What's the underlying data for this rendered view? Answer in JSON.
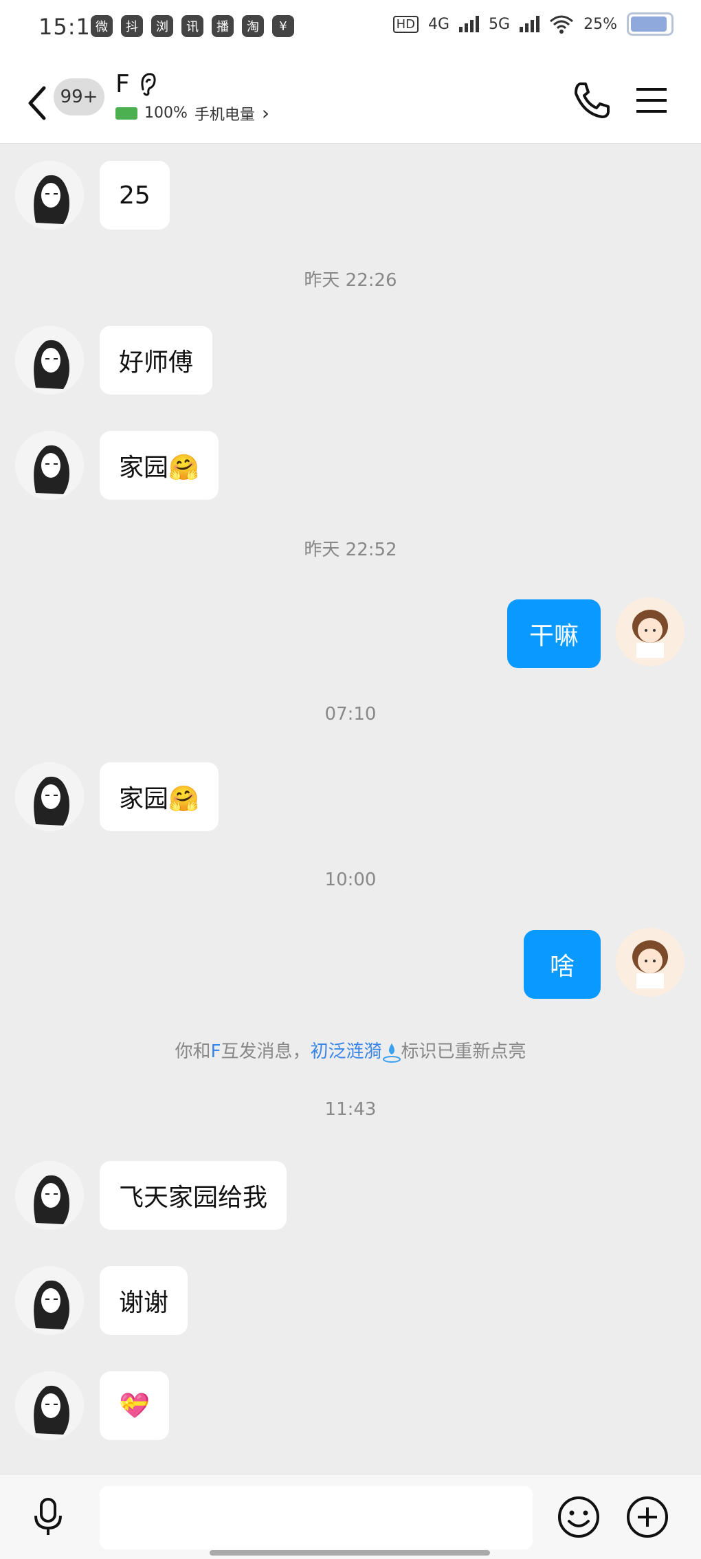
{
  "status_bar": {
    "time": "15:19",
    "apps": [
      "微",
      "抖",
      "浏",
      "讯",
      "播",
      "淘",
      "¥"
    ],
    "hd_label": "HD",
    "network_4g": "4G",
    "network_5g": "5G",
    "battery_percent": "25%"
  },
  "nav": {
    "unread_count": "99+",
    "contact_name": "F",
    "device_battery": "100%",
    "device_label": "手机电量",
    "device_chevron": "›"
  },
  "messages": [
    {
      "type": "in",
      "text": "25"
    },
    {
      "type": "time",
      "text": "昨天 22:26"
    },
    {
      "type": "in",
      "text": "好师傅"
    },
    {
      "type": "in",
      "text": "家园🤗"
    },
    {
      "type": "time",
      "text": "昨天 22:52"
    },
    {
      "type": "out",
      "text": "干嘛"
    },
    {
      "type": "time",
      "text": "07:10"
    },
    {
      "type": "in",
      "text": "家园🤗"
    },
    {
      "type": "time",
      "text": "10:00"
    },
    {
      "type": "out",
      "text": "啥"
    },
    {
      "type": "system",
      "pre": "你和",
      "name": "F",
      "mid": "互发消息，",
      "badge": "初泛涟漪",
      "post": "标识已重新点亮"
    },
    {
      "type": "time",
      "text": "11:43"
    },
    {
      "type": "in",
      "text": "飞天家园给我"
    },
    {
      "type": "in",
      "text": "谢谢"
    },
    {
      "type": "in",
      "text": "💝"
    }
  ],
  "input": {
    "placeholder": ""
  }
}
